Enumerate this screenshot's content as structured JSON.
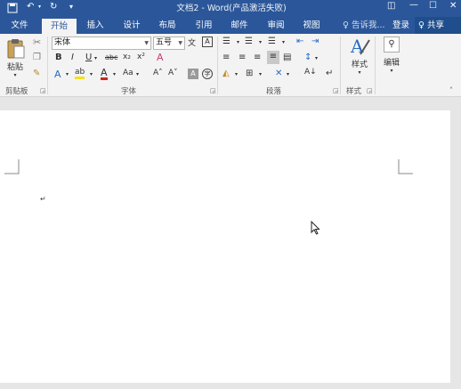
{
  "titlebar": {
    "title": "文档2 - Word(产品激活失败)",
    "qa_save_icon": "save-icon",
    "qa_undo": "↶",
    "qa_redo": "↻",
    "qa_more": "▾",
    "win_options": "◫",
    "win_minimize": "—",
    "win_restore": "☐",
    "win_close": "✕"
  },
  "tabs": [
    {
      "label": "文件"
    },
    {
      "label": "开始"
    },
    {
      "label": "插入"
    },
    {
      "label": "设计"
    },
    {
      "label": "布局"
    },
    {
      "label": "引用"
    },
    {
      "label": "邮件"
    },
    {
      "label": "审阅"
    },
    {
      "label": "视图"
    }
  ],
  "tellme": "♀ 告诉我...",
  "login": "登录",
  "share": "♀ 共享",
  "clipboard": {
    "paste_label": "粘贴",
    "group_label": "剪贴板"
  },
  "font": {
    "name": "宋体",
    "size": "五号",
    "bold": "B",
    "italic": "I",
    "underline": "U",
    "strikethrough": "abc",
    "subscript": "x₂",
    "superscript": "x²",
    "grow": "A˄",
    "shrink": "A˅",
    "case": "Aa",
    "group_label": "字体"
  },
  "paragraph": {
    "group_label": "段落"
  },
  "styles": {
    "label": "样式",
    "group_label": "样式"
  },
  "editing": {
    "label": "编辑"
  },
  "document": {
    "paragraph_mark": "↵"
  },
  "colors": {
    "accent": "#2b579a",
    "ribbon": "#f3f3f3",
    "workspace": "#e6e6e6"
  }
}
